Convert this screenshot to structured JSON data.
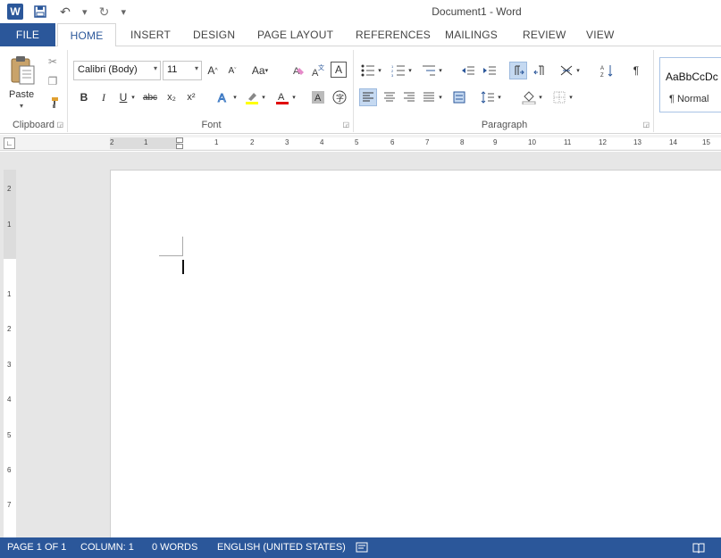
{
  "app": {
    "title": "Document1 - Word"
  },
  "qat": {
    "icons": [
      "word-logo-icon",
      "save-icon",
      "undo-icon",
      "redo-icon",
      "customize-icon"
    ]
  },
  "tabs": [
    "FILE",
    "HOME",
    "INSERT",
    "DESIGN",
    "PAGE LAYOUT",
    "REFERENCES",
    "MAILINGS",
    "REVIEW",
    "VIEW"
  ],
  "ribbon": {
    "clipboard": {
      "label": "Clipboard",
      "paste_label": "Paste"
    },
    "font": {
      "label": "Font",
      "font_name": "Calibri (Body)",
      "font_size": "11",
      "grow": "A",
      "shrink": "A",
      "change_case": "Aa",
      "clear": "A",
      "bold": "B",
      "italic": "I",
      "underline": "U",
      "strike": "abc",
      "subscript": "x₂",
      "superscript": "x²"
    },
    "paragraph": {
      "label": "Paragraph",
      "pilcrow": "¶"
    },
    "styles": {
      "sample": "AaBbCcDc",
      "name": "¶ Normal"
    }
  },
  "ruler": {
    "numbers": [
      "2",
      "1",
      "1",
      "2",
      "3",
      "4",
      "5",
      "6",
      "7",
      "8",
      "9",
      "10",
      "11",
      "12",
      "13",
      "14",
      "15"
    ],
    "vertical": [
      "2",
      "1",
      "1",
      "2",
      "3",
      "4",
      "5",
      "6",
      "7"
    ]
  },
  "status": {
    "page": "PAGE 1 OF 1",
    "column": "COLUMN: 1",
    "words": "0 WORDS",
    "language": "ENGLISH (UNITED STATES)"
  },
  "colors": {
    "accent": "#2b579a",
    "selected_button": "#c5d9f1"
  }
}
